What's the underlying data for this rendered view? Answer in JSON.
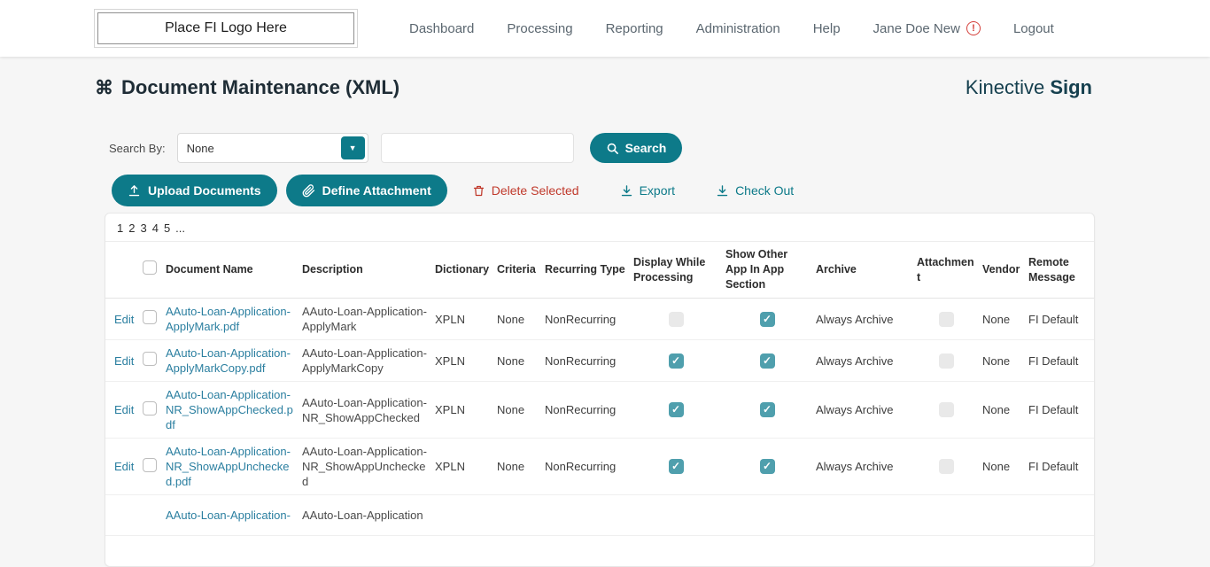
{
  "header": {
    "logo": "Place FI Logo Here",
    "nav": [
      "Dashboard",
      "Processing",
      "Reporting",
      "Administration",
      "Help"
    ],
    "user": "Jane Doe New",
    "logout": "Logout"
  },
  "page": {
    "title": "Document Maintenance (XML)",
    "brand_name": "Kinective",
    "brand_product": "Sign"
  },
  "icons": {
    "title": "⌘",
    "select_caret": "▼",
    "warning": "!"
  },
  "search": {
    "label": "Search By:",
    "selected_option": "None",
    "input_value": "",
    "button_label": "Search"
  },
  "actions": {
    "upload": "Upload Documents",
    "define_attachment": "Define Attachment",
    "delete_selected": "Delete Selected",
    "export": "Export",
    "check_out": "Check Out"
  },
  "table": {
    "pagination": [
      "1",
      "2",
      "3",
      "4",
      "5",
      "..."
    ],
    "edit_label": "Edit",
    "columns": {
      "name": "Document Name",
      "description": "Description",
      "dictionary": "Dictionary",
      "criteria": "Criteria",
      "recurring": "Recurring Type",
      "display": "Display While Processing",
      "show": "Show Other App In App Section",
      "archive": "Archive",
      "attachment": "Attachment",
      "vendor": "Vendor",
      "remote": "Remote Message"
    },
    "rows": [
      {
        "name": "AAuto-Loan-Application-ApplyMark.pdf",
        "description": "AAuto-Loan-Application-ApplyMark",
        "dictionary": "XPLN",
        "criteria": "None",
        "recurring_type": "NonRecurring",
        "display_while_processing": false,
        "show_other_app": true,
        "archive": "Always Archive",
        "attachment": false,
        "vendor": "None",
        "remote_message": "FI Default"
      },
      {
        "name": "AAuto-Loan-Application-ApplyMarkCopy.pdf",
        "description": "AAuto-Loan-Application-ApplyMarkCopy",
        "dictionary": "XPLN",
        "criteria": "None",
        "recurring_type": "NonRecurring",
        "display_while_processing": true,
        "show_other_app": true,
        "archive": "Always Archive",
        "attachment": false,
        "vendor": "None",
        "remote_message": "FI Default"
      },
      {
        "name": "AAuto-Loan-Application-NR_ShowAppChecked.pdf",
        "description": "AAuto-Loan-Application-NR_ShowAppChecked",
        "dictionary": "XPLN",
        "criteria": "None",
        "recurring_type": "NonRecurring",
        "display_while_processing": true,
        "show_other_app": true,
        "archive": "Always Archive",
        "attachment": false,
        "vendor": "None",
        "remote_message": "FI Default"
      },
      {
        "name": "AAuto-Loan-Application-NR_ShowAppUnchecked.pdf",
        "description": "AAuto-Loan-Application-NR_ShowAppUnchecked",
        "dictionary": "XPLN",
        "criteria": "None",
        "recurring_type": "NonRecurring",
        "display_while_processing": true,
        "show_other_app": true,
        "archive": "Always Archive",
        "attachment": false,
        "vendor": "None",
        "remote_message": "FI Default"
      },
      {
        "name": "AAuto-Loan-Application-",
        "description": "AAuto-Loan-Application",
        "dictionary": "",
        "criteria": "",
        "recurring_type": "",
        "display_while_processing": false,
        "show_other_app": false,
        "archive": "",
        "attachment": false,
        "vendor": "",
        "remote_message": ""
      }
    ]
  },
  "colors": {
    "accent_teal": "#0D7A89",
    "link_teal_blue": "#2B7FA0",
    "danger_red": "#C0392B",
    "brand_dark": "#16404F",
    "checkbox_checked": "#4F9FAD"
  }
}
